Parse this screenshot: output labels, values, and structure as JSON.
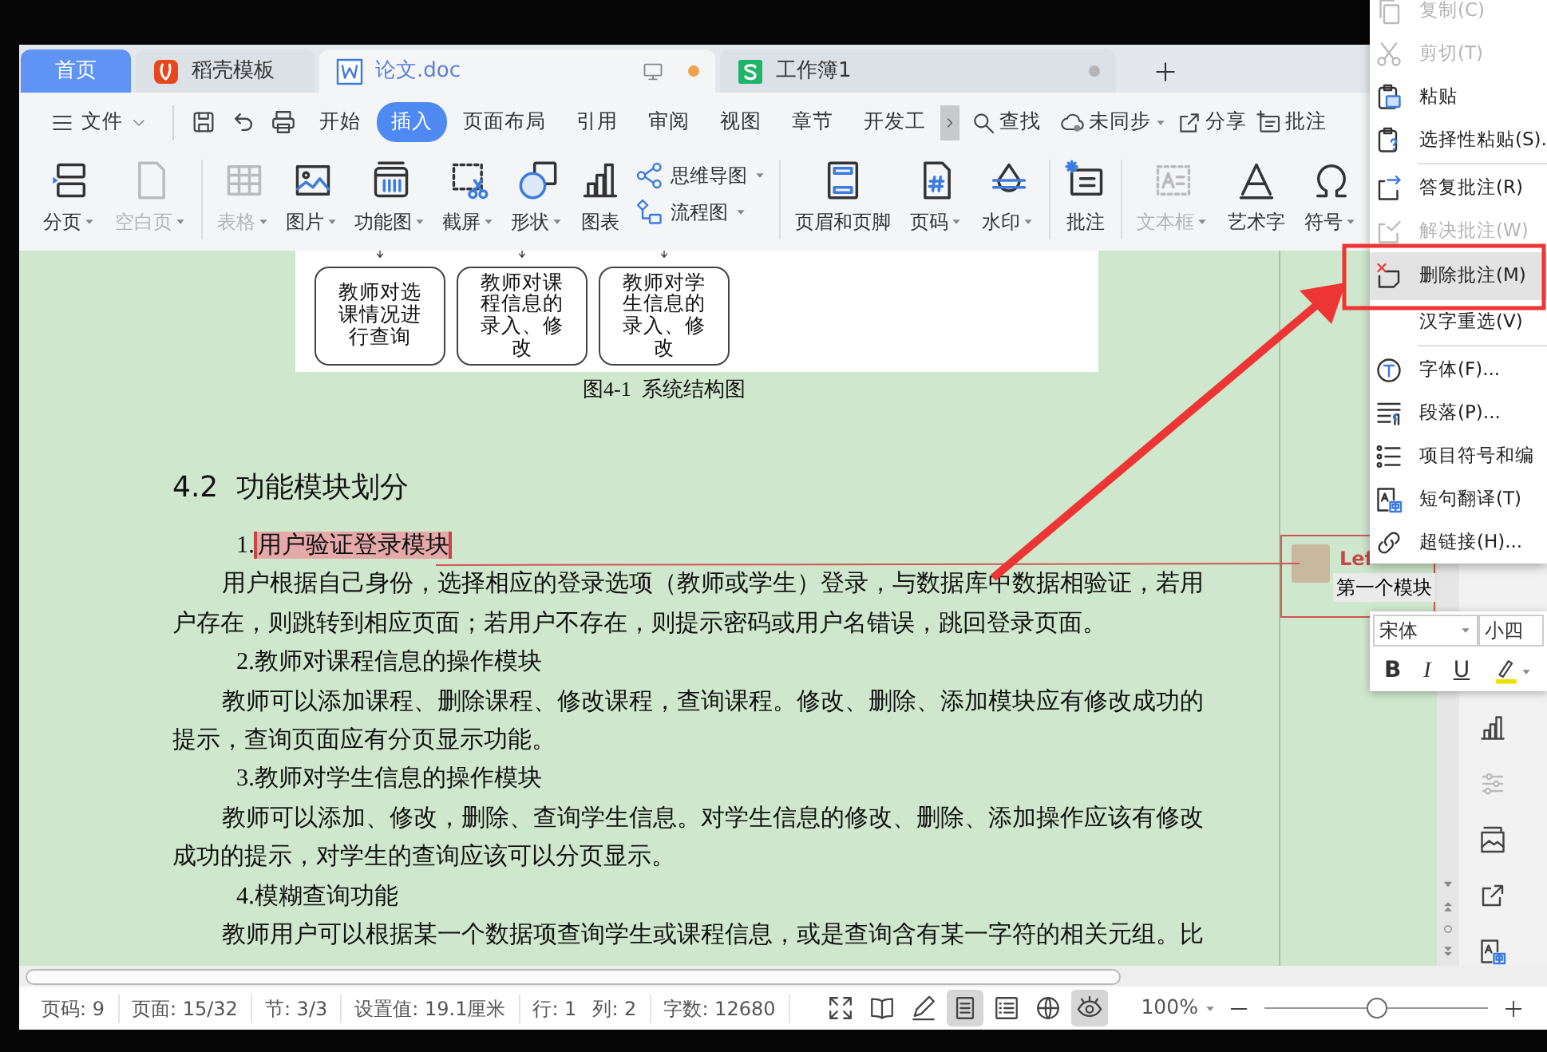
{
  "tabs": [
    {
      "label": "首页",
      "kind": "home",
      "selected": false
    },
    {
      "label": "稻壳模板",
      "kind": "template",
      "selected": false
    },
    {
      "label": "论文.doc",
      "kind": "writer",
      "selected": true,
      "modified": true
    },
    {
      "label": "工作簿1",
      "kind": "sheet",
      "selected": false,
      "modified": false
    }
  ],
  "menu_bar": {
    "file": "文件",
    "quick": [
      {
        "kind": "save"
      },
      {
        "kind": "undo"
      },
      {
        "kind": "print"
      }
    ],
    "tabs": [
      {
        "label": "开始",
        "selected": false
      },
      {
        "label": "插入",
        "selected": true
      },
      {
        "label": "页面布局",
        "selected": false
      },
      {
        "label": "引用",
        "selected": false
      },
      {
        "label": "审阅",
        "selected": false
      },
      {
        "label": "视图",
        "selected": false
      },
      {
        "label": "章节",
        "selected": false
      },
      {
        "label": "开发工",
        "selected": false
      }
    ],
    "actions": [
      {
        "label": "查找",
        "kind": "search",
        "dropdown": false
      },
      {
        "label": "未同步",
        "kind": "sync",
        "dropdown": true
      },
      {
        "label": "分享",
        "kind": "share",
        "dropdown": false
      },
      {
        "label": "批注",
        "kind": "comment-add",
        "dropdown": false
      }
    ]
  },
  "ribbon": [
    [
      {
        "label": "分页",
        "kind": "page-break",
        "dropdown": true,
        "disabled": false
      },
      {
        "label": "空白页",
        "kind": "blank-page",
        "dropdown": true,
        "disabled": true
      }
    ],
    [
      {
        "label": "表格",
        "kind": "table",
        "dropdown": true,
        "disabled": true
      },
      {
        "label": "图片",
        "kind": "picture",
        "dropdown": true,
        "disabled": false
      },
      {
        "label": "功能图",
        "kind": "function-chart",
        "dropdown": true,
        "disabled": false
      },
      {
        "label": "截屏",
        "kind": "screenshot",
        "dropdown": true,
        "disabled": false
      },
      {
        "label": "形状",
        "kind": "shape",
        "dropdown": true,
        "disabled": false
      },
      {
        "label": "图表",
        "kind": "chart",
        "dropdown": false,
        "disabled": false
      },
      {
        "kind": "stack",
        "items": [
          {
            "label": "思维导图",
            "kind": "mindmap",
            "dropdown": true,
            "disabled": false
          },
          {
            "label": "流程图",
            "kind": "flowchart",
            "dropdown": true,
            "disabled": false
          }
        ]
      }
    ],
    [
      {
        "label": "页眉和页脚",
        "kind": "header-footer",
        "dropdown": false,
        "disabled": false
      },
      {
        "label": "页码",
        "kind": "page-number",
        "dropdown": true,
        "disabled": false
      },
      {
        "label": "水印",
        "kind": "watermark",
        "dropdown": true,
        "disabled": false
      }
    ],
    [
      {
        "label": "批注",
        "kind": "comment",
        "dropdown": false,
        "disabled": false
      }
    ],
    [
      {
        "label": "文本框",
        "kind": "textbox",
        "dropdown": true,
        "disabled": true
      },
      {
        "label": "艺术字",
        "kind": "wordart",
        "dropdown": false,
        "disabled": false
      },
      {
        "label": "符号",
        "kind": "symbol",
        "dropdown": true,
        "disabled": false
      }
    ]
  ],
  "document": {
    "figure_boxes": [
      "教师对选课情况进行查询",
      "教师对课程信息的录入、修改",
      "教师对学生信息的录入、修改"
    ],
    "caption": "图4-1  系统结构图",
    "heading": "4.2  功能模块划分",
    "paragraphs": [
      {
        "kind": "item",
        "number": "1.",
        "text": "用户验证登录模块",
        "commented": true
      },
      {
        "kind": "text",
        "text": "用户根据自己身份，选择相应的登录选项（教师或学生）登录，与数据库中数据相验证，若用户存在，则跳转到相应页面；若用户不存在，则提示密码或用户名错误，跳回登录页面。"
      },
      {
        "kind": "item",
        "number": "2.",
        "text": "教师对课程信息的操作模块",
        "commented": false
      },
      {
        "kind": "text",
        "text": "教师可以添加课程、删除课程、修改课程，查询课程。修改、删除、添加模块应有修改成功的提示，查询页面应有分页显示功能。"
      },
      {
        "kind": "item",
        "number": "3.",
        "text": "教师对学生信息的操作模块",
        "commented": false
      },
      {
        "kind": "text",
        "text": "教师可以添加、修改，删除、查询学生信息。对学生信息的修改、删除、添加操作应该有修改成功的提示，对学生的查询应该可以分页显示。"
      },
      {
        "kind": "item",
        "number": "4.",
        "text": "模糊查询功能",
        "commented": false
      },
      {
        "kind": "text",
        "text": "教师用户可以根据某一个数据项查询学生或课程信息，或是查询含有某一字符的相关元组。比"
      }
    ]
  },
  "comment": {
    "author": "Lef",
    "text": "第一个模块"
  },
  "sidebar": [
    {
      "kind": "chart",
      "disabled": false
    },
    {
      "kind": "sliders",
      "disabled": true
    },
    {
      "kind": "image",
      "disabled": false
    },
    {
      "kind": "share",
      "disabled": false
    },
    {
      "kind": "translate",
      "disabled": false
    }
  ],
  "context_menu": [
    [
      {
        "label": "复制(C)",
        "kind": "copy",
        "disabled": true,
        "selected": false
      },
      {
        "label": "剪切(T)",
        "kind": "cut",
        "disabled": true,
        "selected": false
      },
      {
        "label": "粘贴",
        "kind": "paste",
        "disabled": false,
        "selected": false
      },
      {
        "label": "选择性粘贴(S).",
        "kind": "paste-special",
        "disabled": false,
        "selected": false
      }
    ],
    [
      {
        "label": "答复批注(R)",
        "kind": "reply",
        "disabled": false,
        "selected": false
      },
      {
        "label": "解决批注(W)",
        "kind": "resolve",
        "disabled": true,
        "selected": false
      },
      {
        "label": "删除批注(M)",
        "kind": "delete",
        "disabled": false,
        "selected": true
      },
      {
        "label": "汉字重选(V)",
        "kind": "none",
        "disabled": false,
        "selected": false
      }
    ],
    [
      {
        "label": "字体(F)...",
        "kind": "font",
        "disabled": false,
        "selected": false
      },
      {
        "label": "段落(P)...",
        "kind": "paragraph",
        "disabled": false,
        "selected": false
      },
      {
        "label": "项目符号和编",
        "kind": "list",
        "disabled": false,
        "selected": false
      },
      {
        "label": "短句翻译(T)",
        "kind": "translate",
        "disabled": false,
        "selected": false
      },
      {
        "label": "超链接(H)...",
        "kind": "link",
        "disabled": false,
        "selected": false
      }
    ]
  ],
  "mini_toolbar": {
    "font": "宋体",
    "size": "小四",
    "bold": "B",
    "italic": "I",
    "underline": "U"
  },
  "status_bar": {
    "fields": [
      [
        "页码: 9"
      ],
      [
        "页面: 15/32"
      ],
      [
        "节: 3/3"
      ],
      [
        "设置值: 19.1厘米"
      ],
      [
        "行: 1",
        "列: 2"
      ],
      [
        "字数: 12680"
      ]
    ],
    "views": [
      {
        "kind": "fullscreen",
        "selected": false
      },
      {
        "kind": "reading",
        "selected": false
      },
      {
        "kind": "pen",
        "selected": false
      },
      {
        "kind": "page",
        "selected": true
      },
      {
        "kind": "outline",
        "selected": false
      },
      {
        "kind": "web",
        "selected": false
      },
      {
        "kind": "eye-care",
        "selected": true
      }
    ],
    "zoom": "100%",
    "zoom_slider": {
      "level": 0.5
    }
  }
}
